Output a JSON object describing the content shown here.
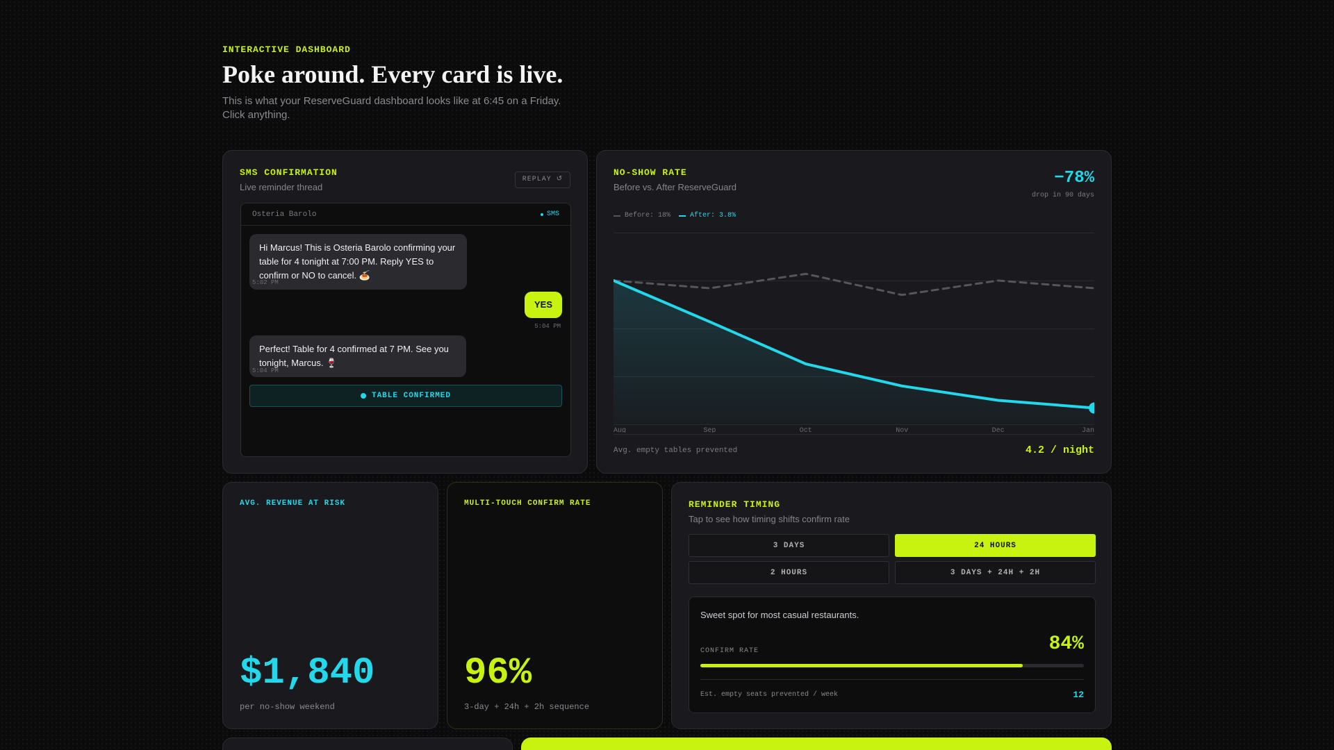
{
  "header": {
    "eyebrow": "INTERACTIVE DASHBOARD",
    "title": "Poke around. Every card is live.",
    "subtitle": "This is what your ReserveGuard dashboard looks like at 6:45 on a Friday. Click anything."
  },
  "sms": {
    "title": "SMS CONFIRMATION",
    "subtitle": "Live reminder thread",
    "replay": "REPLAY ↺",
    "restaurant": "Osteria Barolo",
    "channel": "SMS",
    "messages": [
      {
        "dir": "in",
        "text": "Hi Marcus! This is Osteria Barolo confirming your table for 4 tonight at 7:00 PM. Reply YES to confirm or NO to cancel. 🍝",
        "time": "5:02 PM"
      },
      {
        "dir": "out",
        "text": "YES",
        "time": "5:04 PM"
      },
      {
        "dir": "in",
        "text": "Perfect! Table for 4 confirmed at 7 PM. See you tonight, Marcus. 🍷",
        "time": "5:04 PM"
      }
    ],
    "status": "TABLE CONFIRMED"
  },
  "noshow": {
    "title": "NO-SHOW RATE",
    "subtitle": "Before vs. After ReserveGuard",
    "stat": "−78%",
    "stat_caption": "drop in 90 days",
    "footer_label": "Avg. empty tables prevented",
    "footer_value": "4.2 / night"
  },
  "chart_data": {
    "type": "line",
    "categories": [
      "Aug",
      "Sep",
      "Oct",
      "Nov",
      "Dec",
      "Jan"
    ],
    "series": [
      {
        "name": "Before: 18%",
        "style": "dashed",
        "color": "#55555b",
        "values": [
          13.0,
          12.2,
          13.7,
          11.5,
          13.0,
          12.2
        ]
      },
      {
        "name": "After: 3.8%",
        "style": "solid",
        "color": "#22d8ea",
        "values": [
          13.0,
          8.7,
          4.3,
          2.0,
          0.5,
          -0.3
        ]
      }
    ],
    "ylim": [
      -2,
      18
    ],
    "grid": true
  },
  "revenue": {
    "title": "AVG. REVENUE AT RISK",
    "value": "$1,840",
    "caption": "per no-show weekend"
  },
  "confirm_rate": {
    "title": "MULTI-TOUCH CONFIRM RATE",
    "value": "96%",
    "caption": "3-day + 24h + 2h sequence"
  },
  "timing": {
    "title": "REMINDER TIMING",
    "subtitle": "Tap to see how timing shifts confirm rate",
    "options": [
      "3 DAYS",
      "24 HOURS",
      "2 HOURS",
      "3 DAYS + 24H + 2H"
    ],
    "active_index": 1,
    "description": "Sweet spot for most casual restaurants.",
    "rate_label": "CONFIRM RATE",
    "rate_value": "84%",
    "rate_fraction": 0.84,
    "seats_label": "Est. empty seats prevented / week",
    "seats_value": "12"
  },
  "colors": {
    "accent_lime": "#c8f20f",
    "accent_cyan": "#22d8ea",
    "background": "#0b0b0c",
    "card": "#1a1a1e"
  }
}
